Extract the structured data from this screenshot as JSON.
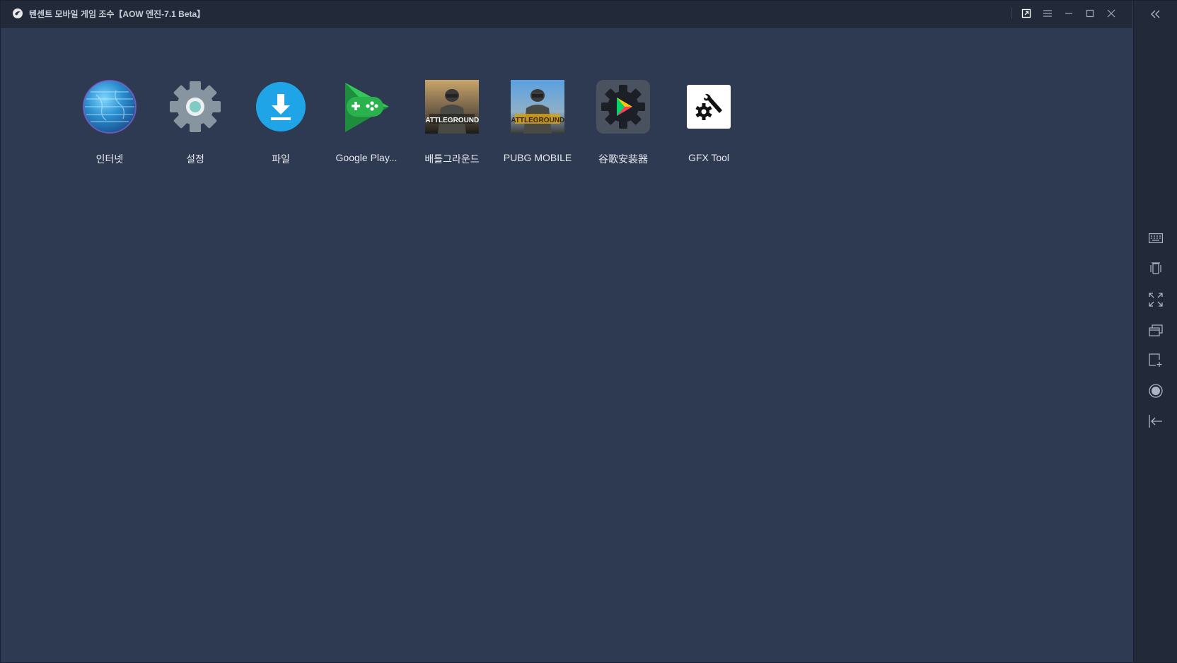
{
  "window": {
    "title": "텐센트 모바일 게임 조수【AOW 엔진-7.1 Beta】"
  },
  "titlebar_icons": [
    "open-external-icon",
    "menu-icon",
    "minimize-icon",
    "maximize-icon",
    "close-icon"
  ],
  "side_panel_icons": [
    "collapse-icon",
    "keyboard-icon",
    "shake-icon",
    "fullscreen-icon",
    "multi-window-icon",
    "screenshot-add-icon",
    "record-icon",
    "exit-icon"
  ],
  "apps": [
    {
      "label": "인터넷",
      "icon": "globe-icon"
    },
    {
      "label": "설정",
      "icon": "settings-gear-icon"
    },
    {
      "label": "파일",
      "icon": "download-file-icon"
    },
    {
      "label": "Google Play...",
      "icon": "google-play-games-icon"
    },
    {
      "label": "배틀그라운드",
      "icon": "battlegrounds-icon",
      "icon_text": "BATTLEGROUNDS"
    },
    {
      "label": "PUBG MOBILE",
      "icon": "pubg-mobile-icon",
      "icon_text": "BATTLEGROUNDS"
    },
    {
      "label": "谷歌安装器",
      "icon": "google-installer-icon"
    },
    {
      "label": "GFX Tool",
      "icon": "gfx-tool-icon"
    }
  ],
  "colors": {
    "desktop_bg": "#2d3a52",
    "titlebar_bg": "#222a3a",
    "label_text": "#e6e9ef"
  }
}
